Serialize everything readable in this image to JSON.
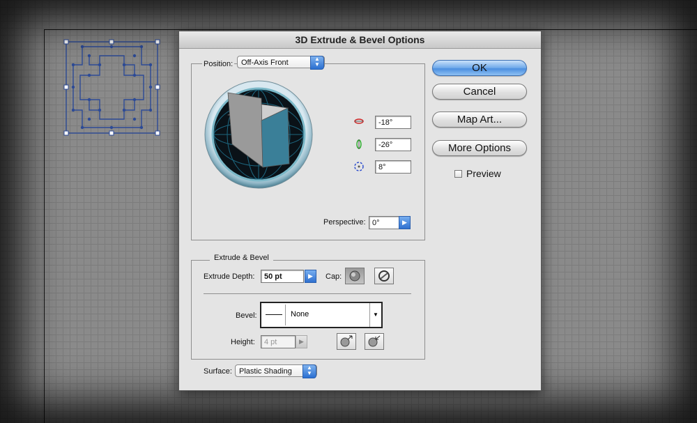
{
  "dialog": {
    "title": "3D Extrude & Bevel Options",
    "position_label": "Position:",
    "position_value": "Off-Axis Front",
    "rotation": {
      "x_value": "-18°",
      "y_value": "-26°",
      "z_value": "8°"
    },
    "perspective_label": "Perspective:",
    "perspective_value": "0°",
    "extrude_group_label": "Extrude & Bevel",
    "extrude_depth_label": "Extrude Depth:",
    "extrude_depth_value": "50 pt",
    "cap_label": "Cap:",
    "bevel_label": "Bevel:",
    "bevel_value": "None",
    "height_label": "Height:",
    "height_value": "4 pt",
    "surface_label": "Surface:",
    "surface_value": "Plastic Shading",
    "buttons": {
      "ok": "OK",
      "cancel": "Cancel",
      "map_art": "Map Art...",
      "more_options": "More Options"
    },
    "preview_label": "Preview",
    "preview_checked": false
  },
  "colors": {
    "accent_blue": "#3d7fd8",
    "cube_front": "#3a7f98",
    "path_blue": "#2c4a96"
  }
}
